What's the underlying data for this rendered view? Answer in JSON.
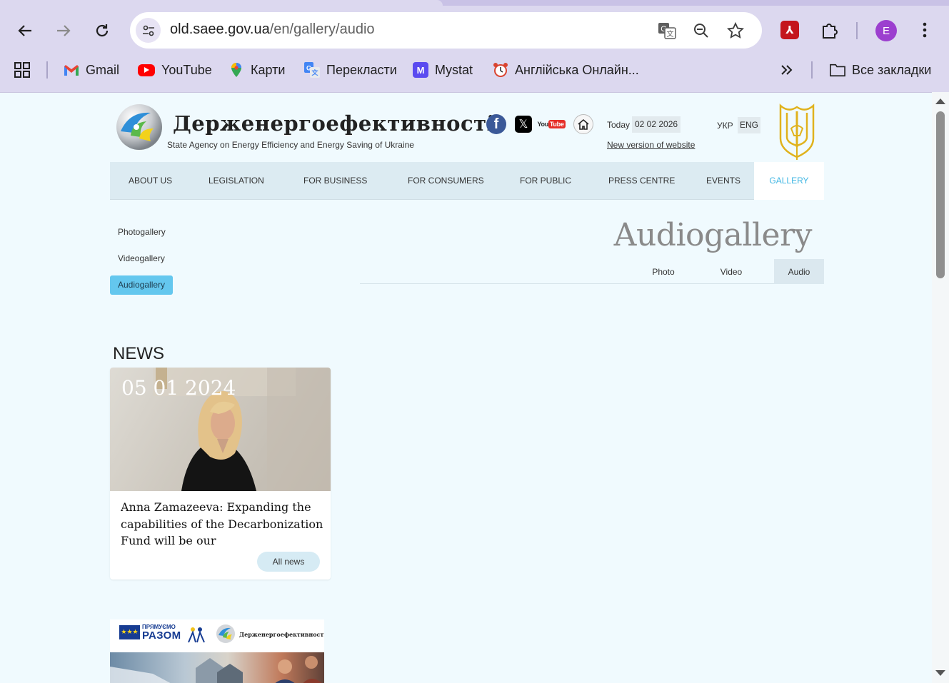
{
  "browser": {
    "url_domain": "old.saee.gov.ua",
    "url_path": "/en/gallery/audio",
    "profile_initial": "E",
    "bookmarks": [
      {
        "label": "Gmail",
        "icon": "gmail-icon"
      },
      {
        "label": "YouTube",
        "icon": "youtube-icon"
      },
      {
        "label": "Карти",
        "icon": "maps-icon"
      },
      {
        "label": "Перекласти",
        "icon": "translate-icon"
      },
      {
        "label": "Mystat",
        "icon": "mystat-icon"
      },
      {
        "label": "Англійська Онлайн...",
        "icon": "alarm-clock-icon"
      }
    ],
    "all_bookmarks_label": "Все закладки"
  },
  "header": {
    "title": "Держенергоефективності",
    "subtitle": "State Agency on Energy Efficiency and Energy Saving of Ukraine",
    "today_label": "Today",
    "today_date": "02 02 2026",
    "new_version_link": "New version of website",
    "lang_ukr": "УКР",
    "lang_eng": "ENG",
    "youtube_text_you": "You",
    "youtube_text_tube": "Tube"
  },
  "main_nav": [
    "ABOUT US",
    "LEGISLATION",
    "FOR BUSINESS",
    "FOR CONSUMERS",
    "FOR PUBLIC",
    "PRESS CENTRE",
    "EVENTS"
  ],
  "main_nav_active": "GALLERY",
  "side_nav": [
    "Photogallery",
    "Videogallery",
    "Audiogallery"
  ],
  "page_title": "Audiogallery",
  "sub_tabs": [
    "Photo",
    "Video",
    "Audio"
  ],
  "news": {
    "heading": "NEWS",
    "date": "05 01 2024",
    "title": "Anna Zamazeeva: Expanding the capabilities of the Decarbonization Fund will be our",
    "all_news_label": "All news"
  },
  "banner": {
    "line1": "ПРЯМУЄМО",
    "line2": "РАЗОМ",
    "agency": "Держенергоефективності"
  },
  "colors": {
    "accent": "#3fb6e3",
    "active_side": "#64c7ee",
    "page_bg": "#f0fafe",
    "chrome_bg": "#dcd8ef"
  }
}
